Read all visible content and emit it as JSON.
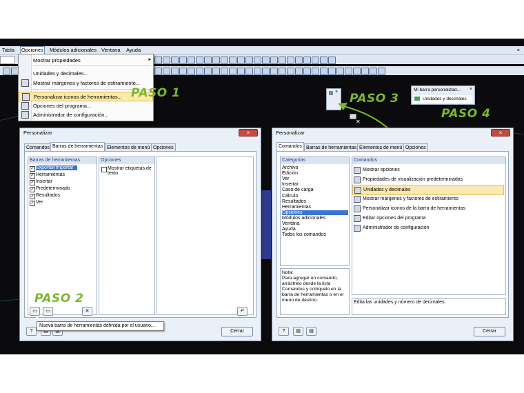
{
  "menubar": {
    "items": [
      "Tabla",
      "Opciones",
      "Módulos adicionales",
      "Ventana",
      "Ayuda"
    ],
    "close": "×"
  },
  "options_menu": {
    "items": [
      {
        "label": "Mostrar propiedades",
        "submenu": "▸",
        "icon": "blank"
      },
      {
        "label": "Unidades y decimales...",
        "icon": "blank"
      },
      {
        "label": "Mostrar márgenes y factores de estiramiento...",
        "icon": "margins-icon"
      },
      {
        "label": "Personalizar iconos de herramientas...",
        "icon": "customize-icon"
      },
      {
        "label": "Opciones del programa...",
        "icon": "options-icon"
      },
      {
        "label": "Administrador de configuración...",
        "icon": "config-icon"
      }
    ]
  },
  "steps": {
    "paso1": "PASO 1",
    "paso2": "PASO 2",
    "paso3": "PASO 3",
    "paso4": "PASO 4"
  },
  "left_dialog": {
    "title": "Personalizar",
    "close": "×",
    "tabs": [
      "Comandos",
      "Barras de herramientas",
      "Elementos de menú",
      "Opciones"
    ],
    "toolbars_title": "Barras de herramientas",
    "toolbars": [
      {
        "label": "Exportar/Importar",
        "checked": true,
        "selected": true
      },
      {
        "label": "Herramientas",
        "checked": true
      },
      {
        "label": "Insertar",
        "checked": true
      },
      {
        "label": "Predeterminado",
        "checked": true
      },
      {
        "label": "Resultados",
        "checked": true
      },
      {
        "label": "Ver",
        "checked": true
      }
    ],
    "options_title": "Opciones",
    "show_labels": "Mostrar etiquetas de texto",
    "tooltip": "Nueva barra de herramientas definida por el usuario...",
    "close_button": "Cerrar"
  },
  "right_dialog": {
    "title": "Personalizar",
    "close": "×",
    "tabs": [
      "Comandos",
      "Barras de herramientas",
      "Elementos de menú",
      "Opciones"
    ],
    "categories_title": "Categorías",
    "categories": [
      "Archivo",
      "Edición",
      "Ver",
      "Insertar",
      "Caso de carga",
      "Cálculo",
      "Resultados",
      "Herramientas",
      "Opciones",
      "Módulos adicionales",
      "Ventana",
      "Ayuda",
      "Todos los comandos"
    ],
    "selected_category": "Opciones",
    "commands_title": "Comandos",
    "commands": [
      {
        "label": "Mostrar opciones",
        "highlight": false
      },
      {
        "label": "Propiedades de visualización predeterminadas",
        "highlight": false
      },
      {
        "label": "Unidades y decimales",
        "highlight": true
      },
      {
        "label": "Mostrar márgenes y factores de estiramiento",
        "highlight": false
      },
      {
        "label": "Personalizar iconos de la barra de herramientas",
        "highlight": false
      },
      {
        "label": "Editar opciones del programa",
        "highlight": false
      },
      {
        "label": "Administrador de configuración",
        "highlight": false
      }
    ],
    "note": "Nota:\nPara agregar un comando, arrástrelo desde la lista Comandos y colóquelo en la barra de herramientas o en el menú de destino.",
    "description": "Edita las unidades y número de decimales.",
    "close_button": "Cerrar"
  },
  "floating_toolbar": {
    "title": "Mi barra personalizad...",
    "close": "×",
    "item": "Unidades y decimales"
  },
  "small_toolbar": {
    "close": "×"
  },
  "colors": {
    "accent_green": "#7ab72f",
    "highlight": "#fce9b2",
    "selection": "#3a75d6"
  }
}
